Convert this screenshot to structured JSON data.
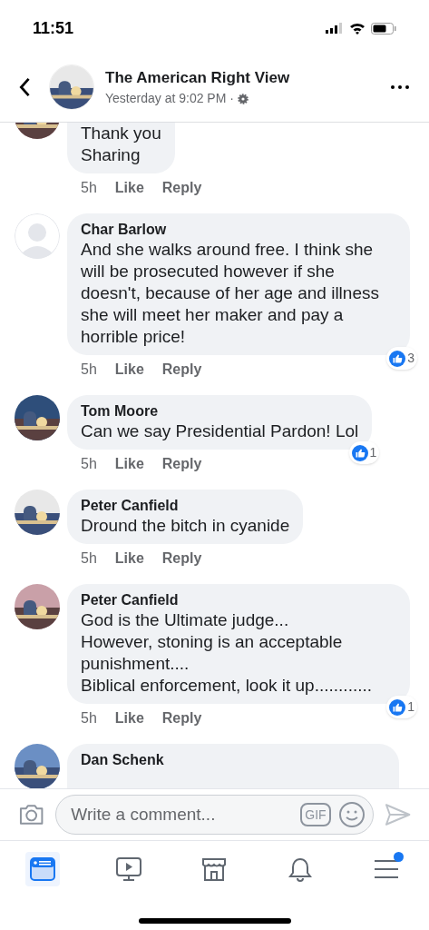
{
  "status_bar": {
    "time": "11:51"
  },
  "header": {
    "title": "The American Right View",
    "subtitle": "Yesterday at 9:02 PM ·"
  },
  "comments": [
    {
      "kind": "cut_top",
      "avatar": {
        "kind": "picture"
      },
      "lines": [
        "Thank you",
        "Sharing"
      ],
      "time": "5h",
      "like": "Like",
      "reply": "Reply"
    },
    {
      "kind": "full",
      "avatar": {
        "kind": "silhouette"
      },
      "name": "Char Barlow",
      "lines": [
        "And she walks around free. I think she will be prosecuted however if she doesn't, because of her age and illness she will meet her maker and pay a horrible price!"
      ],
      "time": "5h",
      "like": "Like",
      "reply": "Reply",
      "reactions": "3"
    },
    {
      "kind": "full",
      "avatar": {
        "kind": "picture"
      },
      "name": "Tom Moore",
      "lines": [
        "Can we say Presidential Pardon! Lol"
      ],
      "time": "5h",
      "like": "Like",
      "reply": "Reply",
      "reactions": "1"
    },
    {
      "kind": "full",
      "avatar": {
        "kind": "picture"
      },
      "name": "Peter Canfield",
      "lines": [
        "Dround the bitch in cyanide"
      ],
      "time": "5h",
      "like": "Like",
      "reply": "Reply"
    },
    {
      "kind": "full",
      "avatar": {
        "kind": "picture"
      },
      "name": "Peter Canfield",
      "lines": [
        "God is the Ultimate judge...",
        "However, stoning is an acceptable punishment....",
        "Biblical enforcement, look it up............"
      ],
      "time": "5h",
      "like": "Like",
      "reply": "Reply",
      "reactions": "1"
    },
    {
      "kind": "cut_bottom",
      "avatar": {
        "kind": "picture"
      },
      "name": "Dan Schenk"
    }
  ],
  "composer": {
    "placeholder": "Write a comment...",
    "gif": "GIF"
  },
  "tabs": [
    {
      "kind": "feed",
      "selected": true,
      "dot": false
    },
    {
      "kind": "watch",
      "selected": false,
      "dot": false
    },
    {
      "kind": "marketplace",
      "selected": false,
      "dot": false
    },
    {
      "kind": "notifications",
      "selected": false,
      "dot": false
    },
    {
      "kind": "menu",
      "selected": false,
      "dot": true
    }
  ]
}
